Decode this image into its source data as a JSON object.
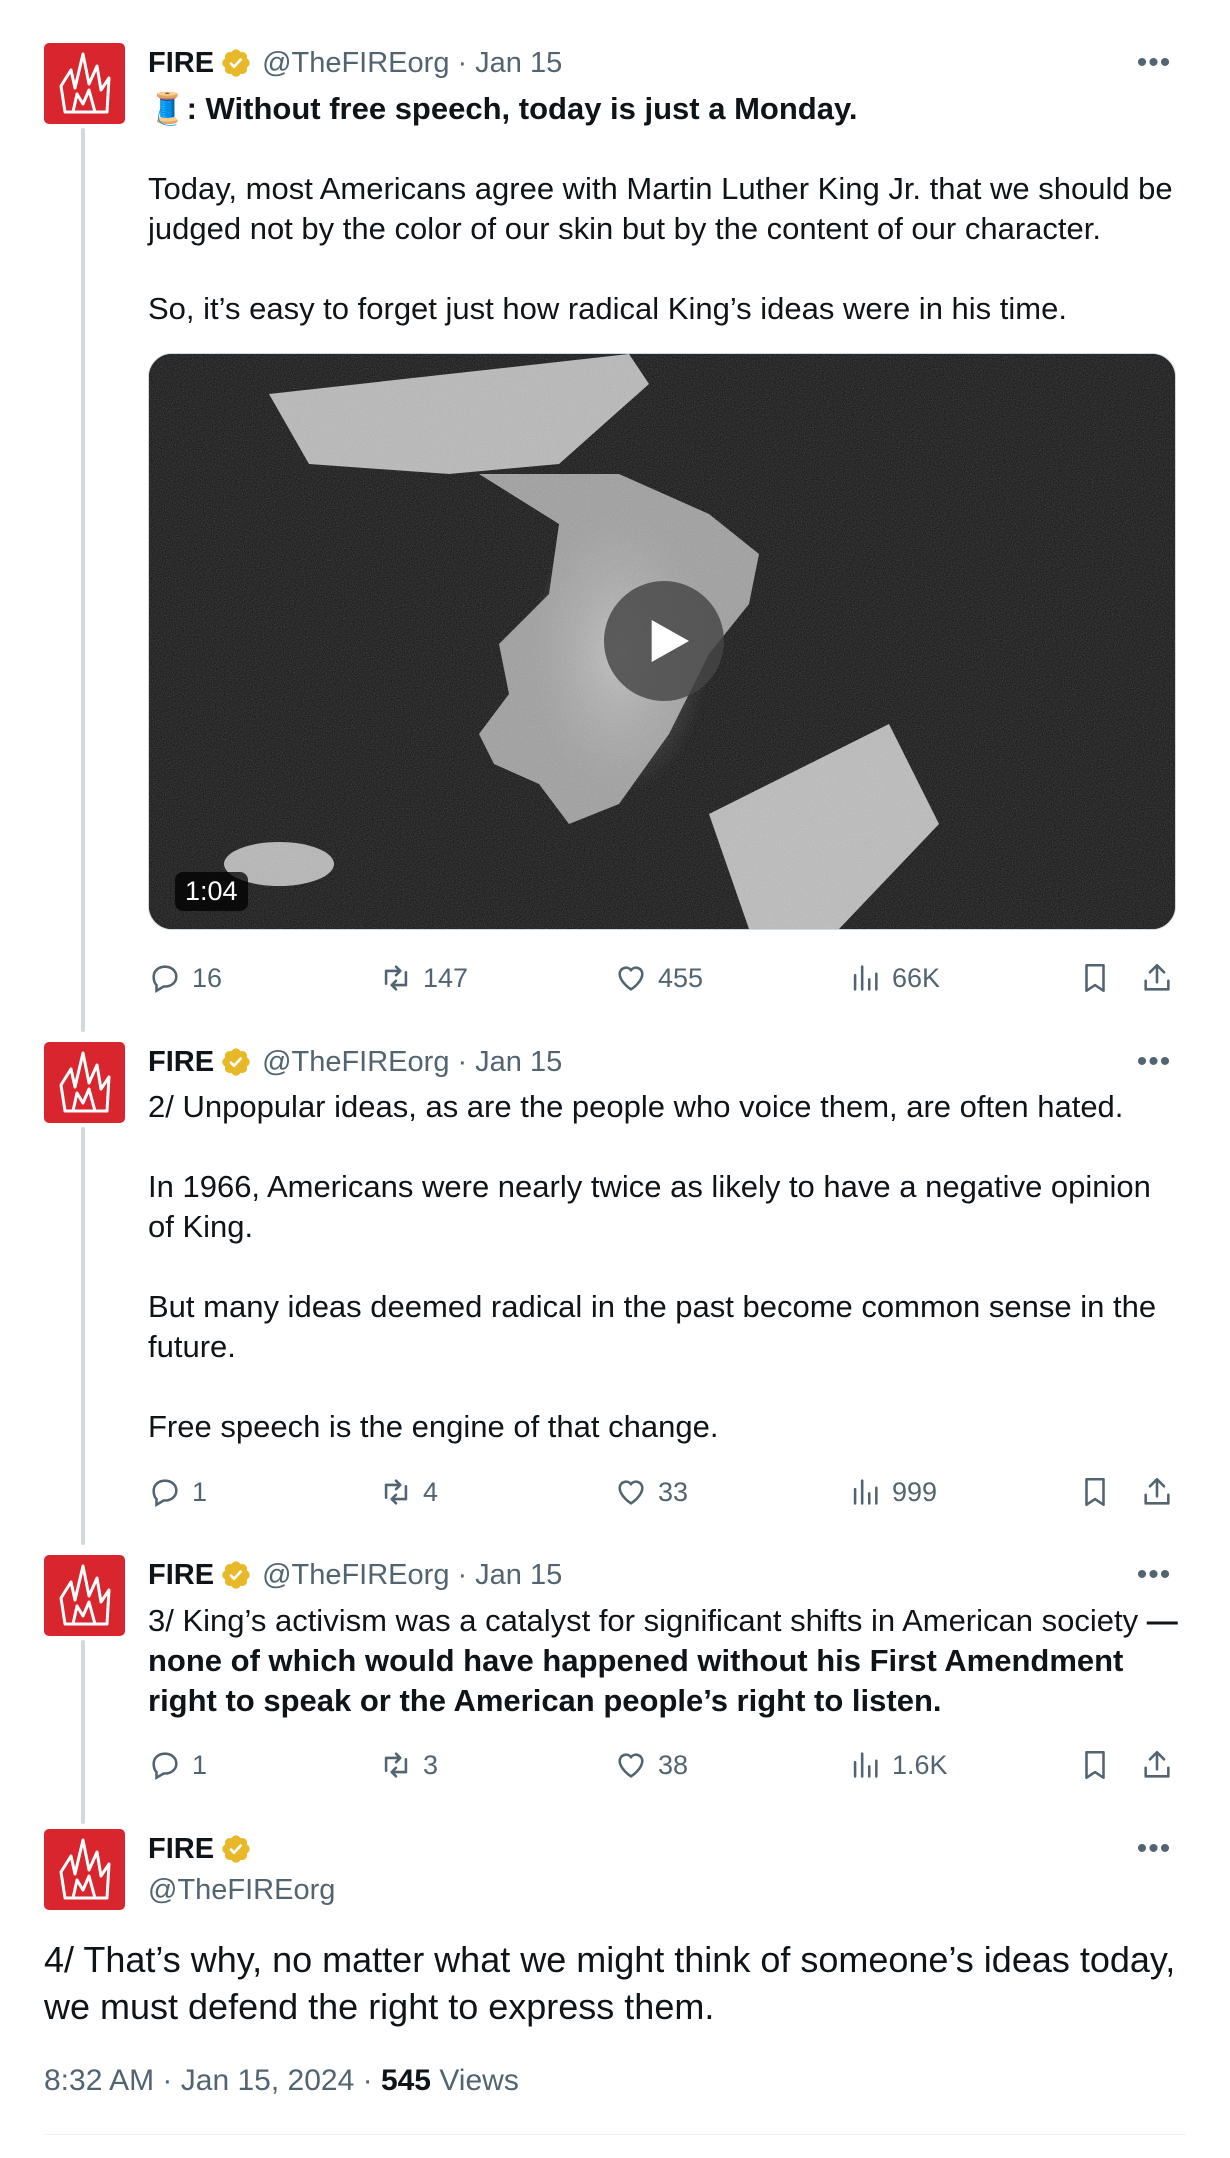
{
  "tweets": [
    {
      "name": "FIRE",
      "handle": "@TheFIREorg",
      "sep": "·",
      "date": "Jan 15",
      "thread_emoji": "🧵",
      "headline": ": Without free speech, today is just a Monday.",
      "paragraphs": [
        "Today, most Americans agree with Martin Luther King Jr. that we should be judged not by the color of our skin but by the content of our character.",
        "So, it’s easy to forget just how radical King’s ideas were in his time."
      ],
      "video_duration": "1:04",
      "replies": "16",
      "retweets": "147",
      "likes": "455",
      "views": "66K"
    },
    {
      "name": "FIRE",
      "handle": "@TheFIREorg",
      "sep": "·",
      "date": "Jan 15",
      "paragraphs": [
        "2/ Unpopular ideas, as are the people who voice them, are often hated.",
        "In 1966, Americans were nearly twice as likely to have a negative opinion of King.",
        "But many ideas deemed radical in the past become common sense in the future.",
        "Free speech is the engine of that change."
      ],
      "replies": "1",
      "retweets": "4",
      "likes": "33",
      "views": "999"
    },
    {
      "name": "FIRE",
      "handle": "@TheFIREorg",
      "sep": "·",
      "date": "Jan 15",
      "text_plain": "3/ King’s activism was a catalyst for significant shifts in American society",
      "text_bold": "— none of which would have happened without his First Amendment right to speak or the American people’s right to listen.",
      "replies": "1",
      "retweets": "3",
      "likes": "38",
      "views": "1.6K"
    }
  ],
  "main_tweet": {
    "name": "FIRE",
    "handle": "@TheFIREorg",
    "text": "4/ That’s why, no matter what we might think of someone’s ideas today, we must defend the right to express them.",
    "time": "8:32 AM",
    "sep": "·",
    "date": "Jan 15, 2024",
    "views_count": "545",
    "views_label": "Views"
  },
  "colors": {
    "brand_red": "#d9252d",
    "verified_gold": "#e8b829",
    "text_primary": "#0f1419",
    "text_secondary": "#536471",
    "thread_line": "#cfd9de"
  },
  "icons": [
    "reply-icon",
    "retweet-icon",
    "like-icon",
    "views-icon",
    "bookmark-icon",
    "share-icon",
    "more-icon",
    "verified-badge-icon",
    "play-icon"
  ]
}
